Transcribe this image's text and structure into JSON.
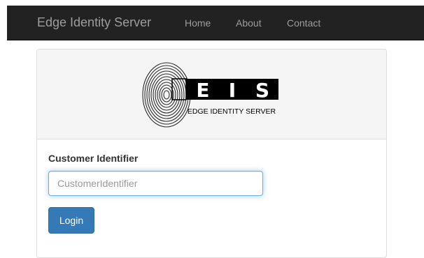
{
  "navbar": {
    "brand": "Edge Identity Server",
    "links": [
      "Home",
      "About",
      "Contact"
    ]
  },
  "logo": {
    "letters": [
      "E",
      "I",
      "S"
    ],
    "caption": "EDGE IDENTITY SERVER",
    "icon": "fingerprint-icon"
  },
  "form": {
    "label": "Customer Identifier",
    "input_value": "",
    "input_placeholder": "CustomerIdentifier",
    "submit_label": "Login"
  },
  "colors": {
    "navbar_bg": "#222222",
    "navbar_text": "#9d9d9d",
    "primary": "#337ab7",
    "focus": "#66afe9"
  }
}
